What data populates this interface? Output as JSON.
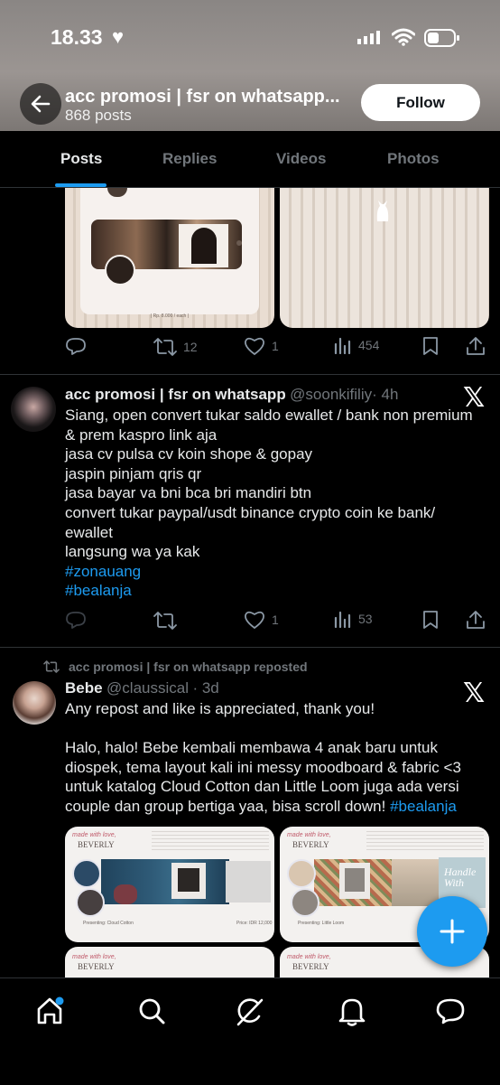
{
  "status": {
    "time": "18.33"
  },
  "header": {
    "title": "acc promosi | fsr on whatsapp...",
    "posts_count": "868 posts",
    "follow_label": "Follow"
  },
  "tabs": [
    {
      "label": "Posts",
      "active": true
    },
    {
      "label": "Replies"
    },
    {
      "label": "Videos"
    },
    {
      "label": "Photos"
    }
  ],
  "post1": {
    "image_caption": "| Rp. 8.000 / each |",
    "stats": {
      "retweets": "12",
      "likes": "1",
      "views": "454"
    }
  },
  "post2": {
    "name": "acc promosi | fsr on whatsapp",
    "handle": "@soonkifiliy",
    "time": "· 4h",
    "lines": [
      "Siang, open convert tukar saldo ewallet / bank non premium",
      "& prem kaspro link aja",
      "jasa cv pulsa cv koin shope & gopay",
      "jaspin pinjam qris qr",
      "jasa bayar va bni bca bri mandiri btn",
      "convert tukar paypal/usdt binance crypto coin ke bank/",
      "ewallet",
      "langsung wa ya kak"
    ],
    "hashtags": [
      "#zonauang",
      "#bealanja"
    ],
    "stats": {
      "retweets": "",
      "likes": "1",
      "views": "53"
    }
  },
  "post3": {
    "repost_label": "acc promosi | fsr on whatsapp reposted",
    "name": "Bebe",
    "handle": "@claussical",
    "time": "· 3d",
    "line1": "Any repost and like is appreciated, thank you!",
    "para_lines": [
      "Halo, halo! Bebe kembali membawa 4 anak baru untuk",
      "diospek, tema layout kali ini messy moodboard & fabric <3",
      "untuk katalog Cloud Cotton dan Little Loom juga ada versi"
    ],
    "last_line": "couple dan group bertiga yaa, bisa scroll down!",
    "last_hashtag": "#bealanja",
    "card1": {
      "brand": "BEVERLY",
      "script": "made with love,",
      "presenting": "Presenting: Cloud Cotton",
      "price": "Price: IDR 12,000"
    },
    "card2": {
      "brand": "BEVERLY",
      "script": "made with love,",
      "presenting": "Presenting: Little Loom",
      "sticker": "Handle With"
    }
  },
  "colors": {
    "accent": "#1d9bf0",
    "background": "#000000",
    "muted": "#71767b",
    "text": "#e7e9ea"
  }
}
